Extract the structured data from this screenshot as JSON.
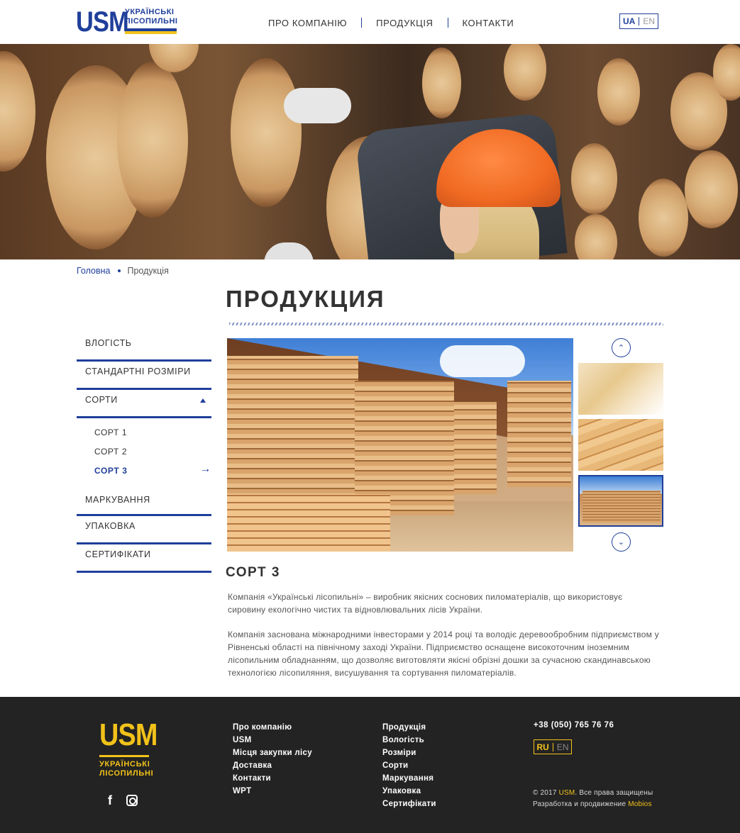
{
  "header": {
    "logo": {
      "mark": "USM",
      "line1": "УКРАЇНСЬКІ",
      "line2": "ЛІСОПИЛЬНІ"
    },
    "nav": [
      "ПРО КОМПАНІЮ",
      "ПРОДУКЦІЯ",
      "КОНТАКТИ"
    ],
    "lang": {
      "active": "UA",
      "inactive": "EN"
    }
  },
  "breadcrumb": {
    "home": "Головна",
    "current": "Продукція"
  },
  "page_title": "ПРОДУКЦИЯ",
  "sidebar": {
    "items": [
      {
        "label": "ВЛОГІСТЬ"
      },
      {
        "label": "СТАНДАРТНІ РОЗМІРИ"
      },
      {
        "label": "СОРТИ",
        "expanded": true
      }
    ],
    "sub_items": [
      {
        "label": "СОРТ 1"
      },
      {
        "label": "СОРТ 2"
      },
      {
        "label": "СОРТ 3",
        "active": true,
        "arrow": "→"
      }
    ],
    "items_after": [
      {
        "label": "МАРКУВАННЯ"
      },
      {
        "label": "УПАКОВКА"
      },
      {
        "label": "СЕРТИФІКАТИ"
      }
    ]
  },
  "gallery": {
    "up_icon": "⌃",
    "down_icon": "⌄",
    "selected_thumb": 3
  },
  "section": {
    "title": "СОРТ 3",
    "paragraphs": [
      "Компанія «Українські лісопильні» – виробник якісних соснових пиломатеріалів, що використовує сировину екологічно чистих та відновлювальних лісів України.",
      "Компанія заснована міжнародними інвесторами у 2014 році та володіє деревообробним підприємством у Рівненські області на північному заході України. Підприємство оснащене високоточним іноземним лісопильним обладнанням, що дозволяє виготовляти якісні обрізні дошки за сучасною скандинавською технологією лісопиляння, висушування та сортування пиломатеріалів."
    ]
  },
  "footer": {
    "logo": {
      "mark": "USM",
      "line1": "УКРАЇНСЬКІ",
      "line2": "ЛІСОПИЛЬНІ"
    },
    "col1": [
      "Про компанію",
      "USM",
      "Місця закупки лісу",
      "Доставка",
      "Контакти",
      "WPT"
    ],
    "col2": [
      "Продукція",
      "Вологість",
      "Розміри",
      "Сорти",
      "Маркування",
      "Упаковка",
      "Сертифікати"
    ],
    "phone": "+38 (050) 765 76 76",
    "lang": {
      "active": "RU",
      "inactive": "EN"
    },
    "copyright_prefix": "© 2017 ",
    "copyright_brand": "USM",
    "copyright_suffix": ". Все права защищены",
    "dev_prefix": "Разработка и продвижение ",
    "dev_brand": "Mobios"
  },
  "colors": {
    "brand_blue": "#1f3f9a",
    "brand_yellow": "#f2c21a",
    "footer_bg": "#232323"
  }
}
